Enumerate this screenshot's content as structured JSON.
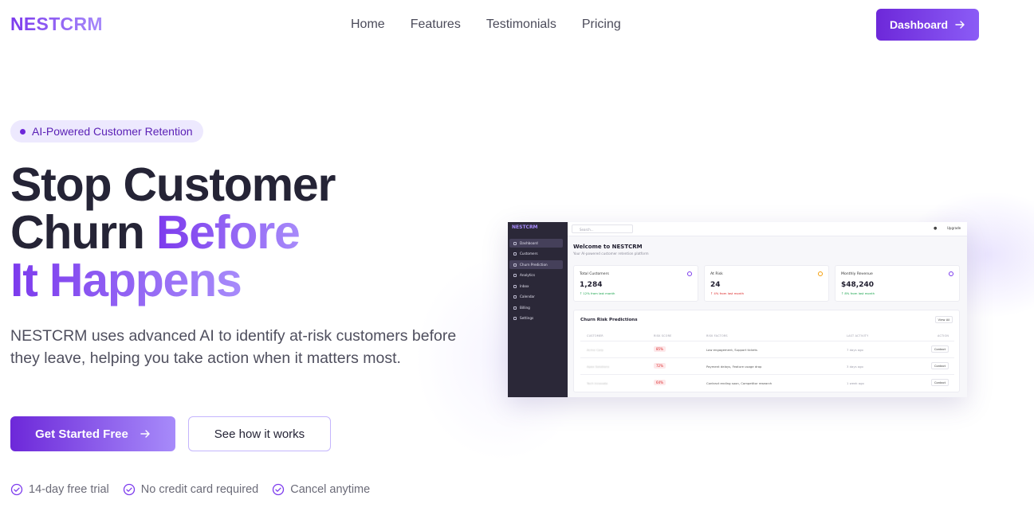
{
  "nav": {
    "brand": "NESTCRM",
    "links": [
      "Home",
      "Features",
      "Testimonials",
      "Pricing"
    ],
    "dashboard_label": "Dashboard"
  },
  "hero": {
    "badge": "AI-Powered Customer Retention",
    "headline_line1": "Stop Customer",
    "headline_line2_plain": "Churn ",
    "headline_line2_accent": "Before",
    "headline_line3": "It Happens",
    "subtitle": "NESTCRM uses advanced AI to identify at-risk customers before they leave, helping you take action when it matters most.",
    "cta_primary": "Get Started Free",
    "cta_secondary": "See how it works",
    "perks": [
      "14-day free trial",
      "No credit card required",
      "Cancel anytime"
    ]
  },
  "mockup": {
    "brand": "NESTCRM",
    "sidebar": [
      "Dashboard",
      "Customers",
      "Churn Prediction",
      "Analytics",
      "Inbox",
      "Calendar",
      "Billing",
      "Settings"
    ],
    "search_placeholder": "Search...",
    "upgrade": "Upgrade",
    "welcome_title": "Welcome to NESTCRM",
    "welcome_sub": "Your AI-powered customer retention platform",
    "cards": [
      {
        "label": "Total Customers",
        "value": "1,284",
        "change": "↑ 12% from last month"
      },
      {
        "label": "At Risk",
        "value": "24",
        "change": "↑ 4% from last month"
      },
      {
        "label": "Monthly Revenue",
        "value": "$48,240",
        "change": "↑ 8% from last month"
      }
    ],
    "table_title": "Churn Risk Predictions",
    "view_all": "View All",
    "columns": [
      "CUSTOMER",
      "RISK SCORE",
      "RISK FACTORS",
      "LAST ACTIVITY",
      "ACTION"
    ],
    "rows": [
      {
        "customer": "Acme Corp",
        "risk": "85%",
        "factors": "Low engagement, Support tickets",
        "last": "7 days ago",
        "action": "Contact"
      },
      {
        "customer": "Apex Solutions",
        "risk": "72%",
        "factors": "Payment delays, Feature usage drop",
        "last": "3 days ago",
        "action": "Contact"
      },
      {
        "customer": "Tech Innovate",
        "risk": "64%",
        "factors": "Contract ending soon, Competitor research",
        "last": "1 week ago",
        "action": "Contact"
      }
    ]
  },
  "colors": {
    "accent": "#7c3aed",
    "accent_light": "#a78bfa",
    "badge_bg": "#ede9fe",
    "risk": "#dc2626"
  }
}
